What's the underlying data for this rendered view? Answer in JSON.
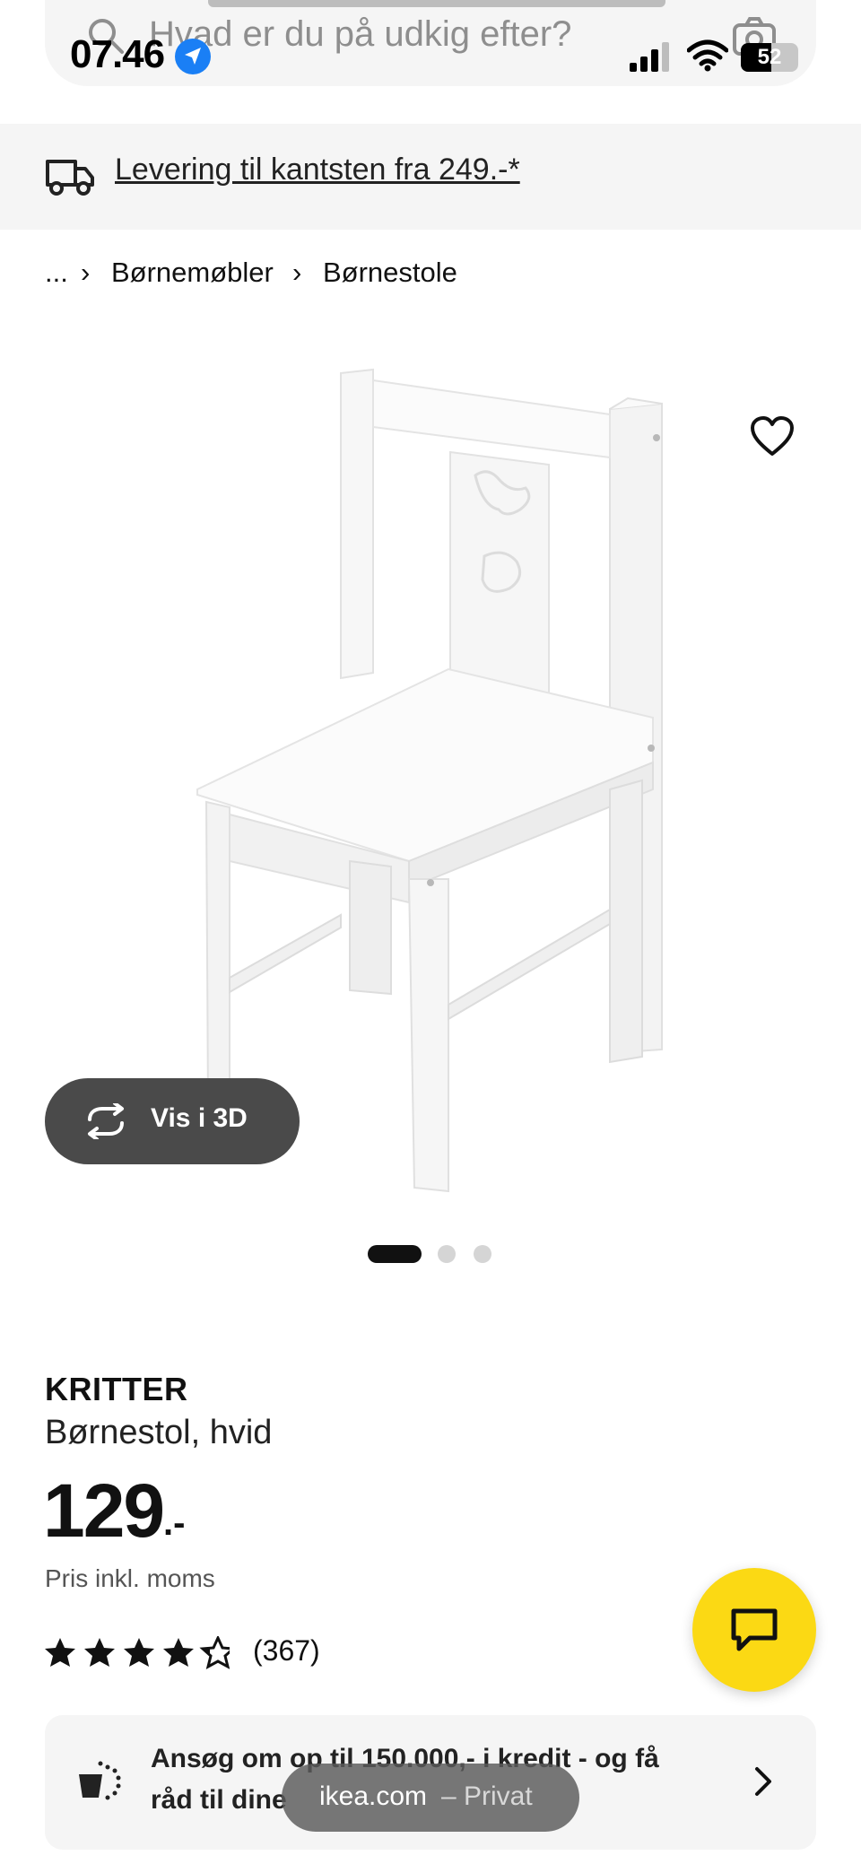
{
  "status_bar": {
    "time": "07.46",
    "battery": "52"
  },
  "search": {
    "placeholder": "Hvad er du på udkig efter?"
  },
  "delivery_banner": {
    "text": "Levering til kantsten fra 249.-*"
  },
  "breadcrumb": {
    "ellipsis": "...",
    "separator": "›",
    "items": [
      "Børnemøbler",
      "Børnestole"
    ]
  },
  "gallery": {
    "vis_3d_label": "Vis i 3D",
    "total_images": 3,
    "active_index": 0
  },
  "product": {
    "brand": "KRITTER",
    "description": "Børnestol, hvid",
    "price": "129",
    "price_suffix": ".-",
    "price_note": "Pris inkl. moms",
    "rating_stars": 4.5,
    "rating_count": "(367)"
  },
  "credit_offer": {
    "line1": "Ansøg om op til 150.000,- i kredit - og få",
    "line2": "råd til dine"
  },
  "safari": {
    "domain": "ikea.com",
    "mode": "– Privat"
  },
  "colors": {
    "brand_yellow": "#fbd914",
    "panel_gray": "#f5f5f5",
    "button_dark": "#4a4a4a"
  }
}
